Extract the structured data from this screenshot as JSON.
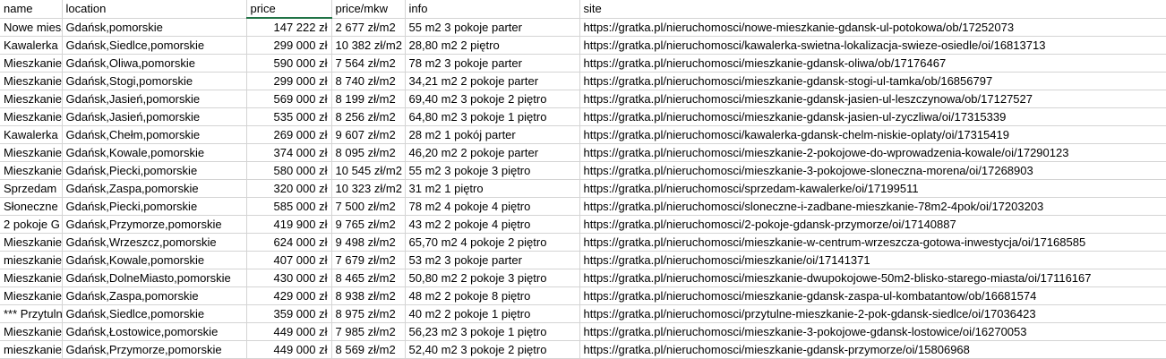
{
  "headers": [
    "name",
    "location",
    "price",
    "price/mkw",
    "info",
    "site"
  ],
  "rows": [
    {
      "name": "Nowe mieszkanie",
      "location": "Gdańsk,pomorskie",
      "price": "147 222 zł",
      "price_mkw": "2 677 zł/m2",
      "info": "55 m2 3 pokoje parter",
      "site": "https://gratka.pl/nieruchomosci/nowe-mieszkanie-gdansk-ul-potokowa/ob/17252073"
    },
    {
      "name": "Kawalerka",
      "location": "Gdańsk,Siedlce,pomorskie",
      "price": "299 000 zł",
      "price_mkw": "10 382 zł/m2",
      "info": "28,80 m2 2 piętro",
      "site": "https://gratka.pl/nieruchomosci/kawalerka-swietna-lokalizacja-swieze-osiedle/oi/16813713"
    },
    {
      "name": "Mieszkanie",
      "location": "Gdańsk,Oliwa,pomorskie",
      "price": "590 000 zł",
      "price_mkw": "7 564 zł/m2",
      "info": "78 m2 3 pokoje parter",
      "site": "https://gratka.pl/nieruchomosci/mieszkanie-gdansk-oliwa/ob/17176467"
    },
    {
      "name": "Mieszkanie",
      "location": "Gdańsk,Stogi,pomorskie",
      "price": "299 000 zł",
      "price_mkw": "8 740 zł/m2",
      "info": "34,21 m2 2 pokoje parter",
      "site": "https://gratka.pl/nieruchomosci/mieszkanie-gdansk-stogi-ul-tamka/ob/16856797"
    },
    {
      "name": "Mieszkanie",
      "location": "Gdańsk,Jasień,pomorskie",
      "price": "569 000 zł",
      "price_mkw": "8 199 zł/m2",
      "info": "69,40 m2 3 pokoje 2 piętro",
      "site": "https://gratka.pl/nieruchomosci/mieszkanie-gdansk-jasien-ul-leszczynowa/ob/17127527"
    },
    {
      "name": "Mieszkanie",
      "location": "Gdańsk,Jasień,pomorskie",
      "price": "535 000 zł",
      "price_mkw": "8 256 zł/m2",
      "info": "64,80 m2 3 pokoje 1 piętro",
      "site": "https://gratka.pl/nieruchomosci/mieszkanie-gdansk-jasien-ul-zyczliwa/oi/17315339"
    },
    {
      "name": "Kawalerka",
      "location": "Gdańsk,Chełm,pomorskie",
      "price": "269 000 zł",
      "price_mkw": "9 607 zł/m2",
      "info": "28 m2 1 pokój parter",
      "site": "https://gratka.pl/nieruchomosci/kawalerka-gdansk-chelm-niskie-oplaty/oi/17315419"
    },
    {
      "name": "Mieszkanie",
      "location": "Gdańsk,Kowale,pomorskie",
      "price": "374 000 zł",
      "price_mkw": "8 095 zł/m2",
      "info": "46,20 m2 2 pokoje parter",
      "site": "https://gratka.pl/nieruchomosci/mieszkanie-2-pokojowe-do-wprowadzenia-kowale/oi/17290123"
    },
    {
      "name": "Mieszkanie",
      "location": "Gdańsk,Piecki,pomorskie",
      "price": "580 000 zł",
      "price_mkw": "10 545 zł/m2",
      "info": "55 m2 3 pokoje 3 piętro",
      "site": "https://gratka.pl/nieruchomosci/mieszkanie-3-pokojowe-sloneczna-morena/oi/17268903"
    },
    {
      "name": "Sprzedam",
      "location": "Gdańsk,Zaspa,pomorskie",
      "price": "320 000 zł",
      "price_mkw": "10 323 zł/m2",
      "info": "31 m2 1 piętro",
      "site": "https://gratka.pl/nieruchomosci/sprzedam-kawalerke/oi/17199511"
    },
    {
      "name": "Słoneczne",
      "location": "Gdańsk,Piecki,pomorskie",
      "price": "585 000 zł",
      "price_mkw": "7 500 zł/m2",
      "info": "78 m2 4 pokoje 4 piętro",
      "site": "https://gratka.pl/nieruchomosci/sloneczne-i-zadbane-mieszkanie-78m2-4pok/oi/17203203"
    },
    {
      "name": "2 pokoje G",
      "location": "Gdańsk,Przymorze,pomorskie",
      "price": "419 900 zł",
      "price_mkw": "9 765 zł/m2",
      "info": "43 m2 2 pokoje 4 piętro",
      "site": "https://gratka.pl/nieruchomosci/2-pokoje-gdansk-przymorze/oi/17140887"
    },
    {
      "name": "Mieszkanie",
      "location": "Gdańsk,Wrzeszcz,pomorskie",
      "price": "624 000 zł",
      "price_mkw": "9 498 zł/m2",
      "info": "65,70 m2 4 pokoje 2 piętro",
      "site": "https://gratka.pl/nieruchomosci/mieszkanie-w-centrum-wrzeszcza-gotowa-inwestycja/oi/17168585"
    },
    {
      "name": "mieszkanie",
      "location": "Gdańsk,Kowale,pomorskie",
      "price": "407 000 zł",
      "price_mkw": "7 679 zł/m2",
      "info": "53 m2 3 pokoje parter",
      "site": "https://gratka.pl/nieruchomosci/mieszkanie/oi/17141371"
    },
    {
      "name": "Mieszkanie",
      "location": "Gdańsk,DolneMiasto,pomorskie",
      "price": "430 000 zł",
      "price_mkw": "8 465 zł/m2",
      "info": "50,80 m2 2 pokoje 3 piętro",
      "site": "https://gratka.pl/nieruchomosci/mieszkanie-dwupokojowe-50m2-blisko-starego-miasta/oi/17116167"
    },
    {
      "name": "Mieszkanie",
      "location": "Gdańsk,Zaspa,pomorskie",
      "price": "429 000 zł",
      "price_mkw": "8 938 zł/m2",
      "info": "48 m2 2 pokoje 8 piętro",
      "site": "https://gratka.pl/nieruchomosci/mieszkanie-gdansk-zaspa-ul-kombatantow/ob/16681574"
    },
    {
      "name": "*** Przytulne",
      "location": "Gdańsk,Siedlce,pomorskie",
      "price": "359 000 zł",
      "price_mkw": "8 975 zł/m2",
      "info": "40 m2 2 pokoje 1 piętro",
      "site": "https://gratka.pl/nieruchomosci/przytulne-mieszkanie-2-pok-gdansk-siedlce/oi/17036423"
    },
    {
      "name": "Mieszkanie",
      "location": "Gdańsk,Łostowice,pomorskie",
      "price": "449 000 zł",
      "price_mkw": "7 985 zł/m2",
      "info": "56,23 m2 3 pokoje 1 piętro",
      "site": "https://gratka.pl/nieruchomosci/mieszkanie-3-pokojowe-gdansk-lostowice/oi/16270053"
    },
    {
      "name": "mieszkanie",
      "location": "Gdańsk,Przymorze,pomorskie",
      "price": "449 000 zł",
      "price_mkw": "8 569 zł/m2",
      "info": "52,40 m2 3 pokoje 2 piętro",
      "site": "https://gratka.pl/nieruchomosci/mieszkanie-gdansk-przymorze/oi/15806968"
    }
  ]
}
